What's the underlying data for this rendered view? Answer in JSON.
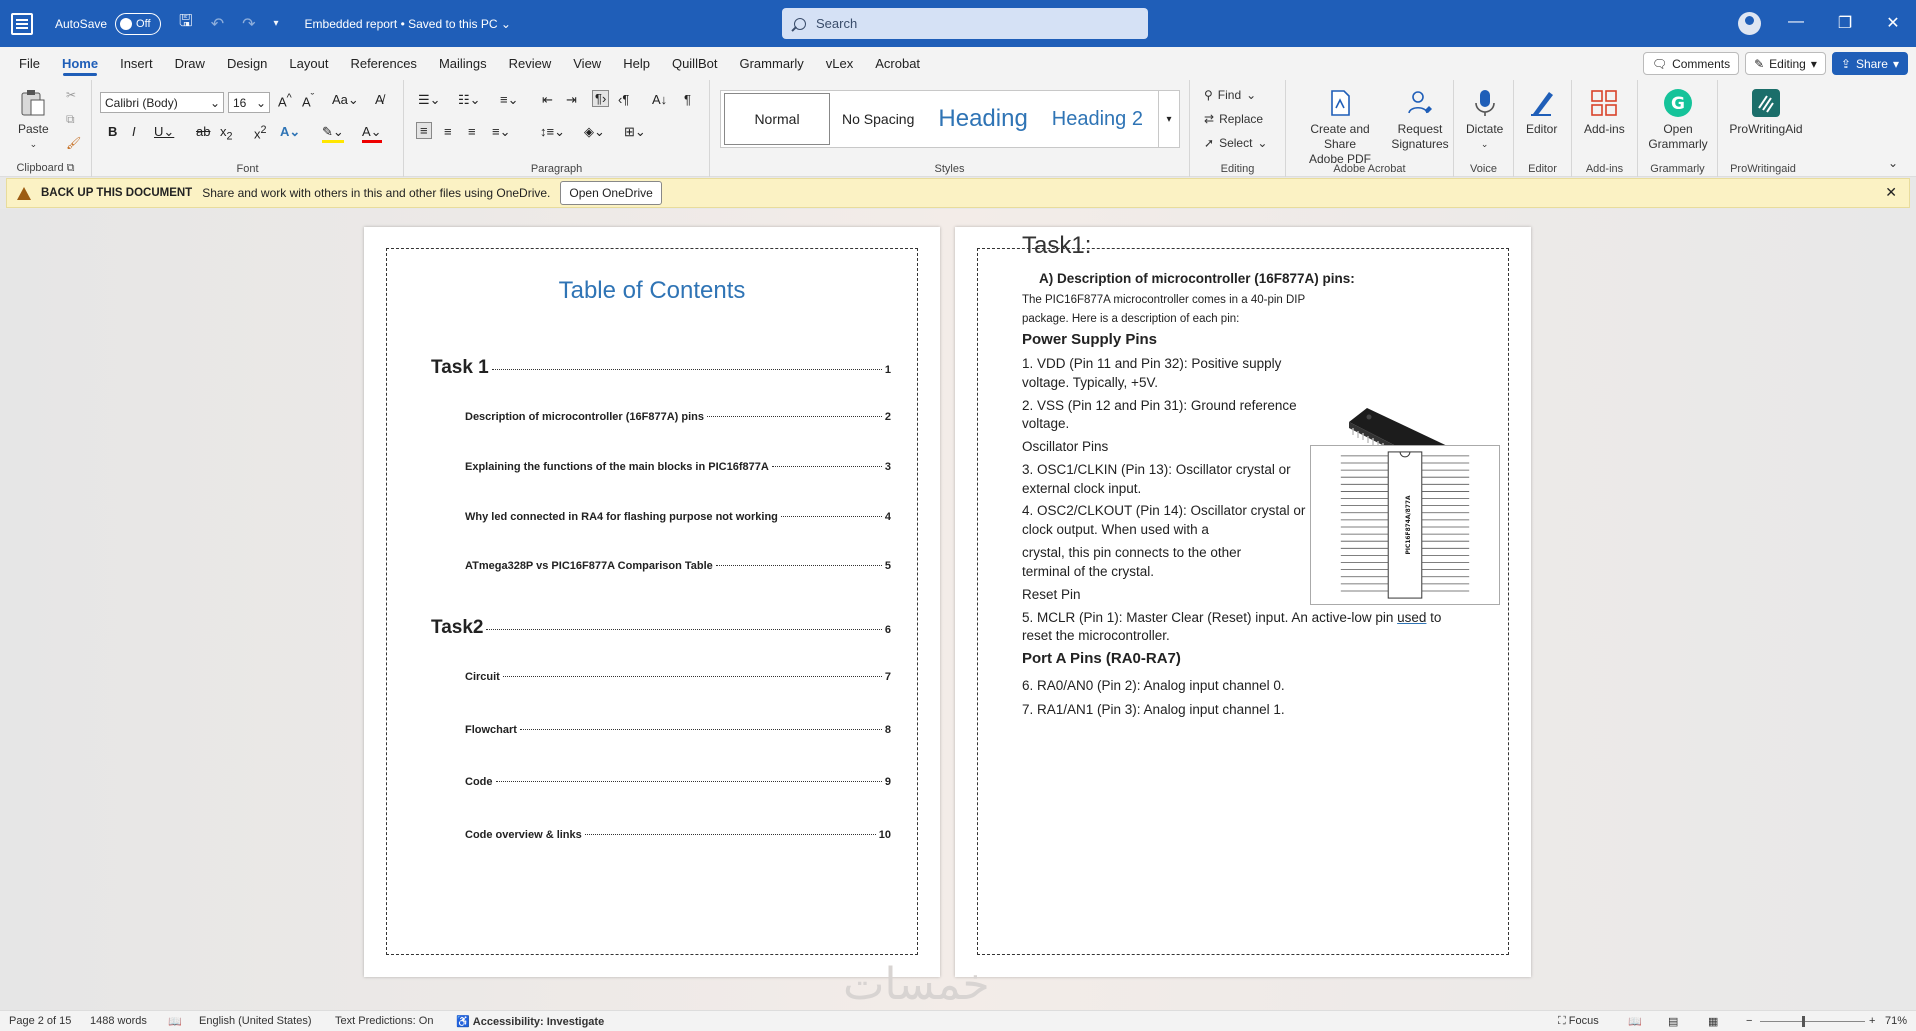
{
  "titlebar": {
    "autosave_label": "AutoSave",
    "autosave_state": "Off",
    "doc_title": "Embedded report • Saved to this PC",
    "search_placeholder": "Search"
  },
  "menu": {
    "tabs": [
      "File",
      "Home",
      "Insert",
      "Draw",
      "Design",
      "Layout",
      "References",
      "Mailings",
      "Review",
      "View",
      "Help",
      "QuillBot",
      "Grammarly",
      "vLex",
      "Acrobat"
    ],
    "active": "Home",
    "comments_label": "Comments",
    "editing_label": "Editing",
    "share_label": "Share"
  },
  "ribbon": {
    "clipboard": {
      "paste": "Paste",
      "label": "Clipboard"
    },
    "font": {
      "family": "Calibri (Body)",
      "size": "16",
      "label": "Font"
    },
    "paragraph": {
      "label": "Paragraph"
    },
    "styles": {
      "items": [
        "Normal",
        "No Spacing",
        "Heading",
        "Heading 2"
      ],
      "label": "Styles"
    },
    "editing": {
      "find": "Find",
      "replace": "Replace",
      "select": "Select",
      "label": "Editing"
    },
    "acrobat": {
      "create": "Create and Share\nAdobe PDF",
      "request": "Request\nSignatures",
      "label": "Adobe Acrobat"
    },
    "voice": {
      "dictate": "Dictate",
      "label": "Voice"
    },
    "editor": {
      "editor": "Editor",
      "label": "Editor"
    },
    "addins": {
      "addins": "Add-ins",
      "label": "Add-ins"
    },
    "grammarly": {
      "open": "Open\nGrammarly",
      "label": "Grammarly"
    },
    "prowriting": {
      "name": "ProWritingAid",
      "label": "ProWritingaid"
    },
    "accent": "#1f5eb8"
  },
  "notification": {
    "title": "BACK UP THIS DOCUMENT",
    "message": "Share and work with others in this and other files using OneDrive.",
    "button": "Open OneDrive"
  },
  "page1": {
    "toc_title": "Table of Contents",
    "entries": [
      {
        "text": "Task 1",
        "page": "1",
        "level": 1
      },
      {
        "text": "Description of microcontroller (16F877A) pins",
        "page": "2",
        "level": 2
      },
      {
        "text": "Explaining the functions of the main blocks in PIC16f877A",
        "page": "3",
        "level": 2
      },
      {
        "text": "Why led connected in RA4 for flashing purpose not working",
        "page": "4",
        "level": 2
      },
      {
        "text": "ATmega328P vs PIC16F877A Comparison Table",
        "page": "5",
        "level": 2
      },
      {
        "text": "Task2",
        "page": "6",
        "level": 1
      },
      {
        "text": "Circuit",
        "page": "7",
        "level": 2
      },
      {
        "text": "Flowchart",
        "page": "8",
        "level": 2
      },
      {
        "text": "Code",
        "page": "9",
        "level": 2
      },
      {
        "text": "Code overview & links",
        "page": "10",
        "level": 2
      }
    ]
  },
  "page2": {
    "task": "Task1:",
    "subhead": "A)  Description of microcontroller (16F877A) pins:",
    "intro1": "The PIC16F877A microcontroller comes in a 40-pin DIP",
    "intro2": "package. Here is a description of each pin:",
    "power_heading": "Power Supply Pins",
    "p1a": "1. VDD (Pin 11 and Pin 32): Positive supply",
    "p1b": "voltage. Typically, +5V.",
    "p2a": "2. VSS (Pin 12 and Pin 31): Ground reference",
    "p2b": "voltage.",
    "osc_heading": "Oscillator Pins",
    "p3a": "3. OSC1/CLKIN (Pin 13): Oscillator crystal or",
    "p3b": "external clock input.",
    "p4a": "4. OSC2/CLKOUT (Pin 14): Oscillator crystal or",
    "p4b": "clock output. When used with a",
    "p4c": "crystal, this pin connects to the other",
    "p4d": "terminal of the crystal.",
    "reset_heading": "Reset Pin",
    "p5a_pre": "5. MCLR (Pin 1): Master Clear (Reset) input. An active-low pin ",
    "p5a_used": "used",
    "p5a_post": " to",
    "p5b": "reset the microcontroller.",
    "porta_heading": "Port A Pins (RA0-RA7)",
    "p6": "6. RA0/AN0 (Pin 2): Analog input channel 0.",
    "p7": "7. RA1/AN1 (Pin 3): Analog input channel 1.",
    "chip_label": "PIC16F874A/877A"
  },
  "status": {
    "page": "Page 2 of 15",
    "words": "1488 words",
    "language": "English (United States)",
    "predictions": "Text Predictions: On",
    "accessibility": "Accessibility: Investigate",
    "focus": "Focus",
    "zoom": "71%"
  }
}
